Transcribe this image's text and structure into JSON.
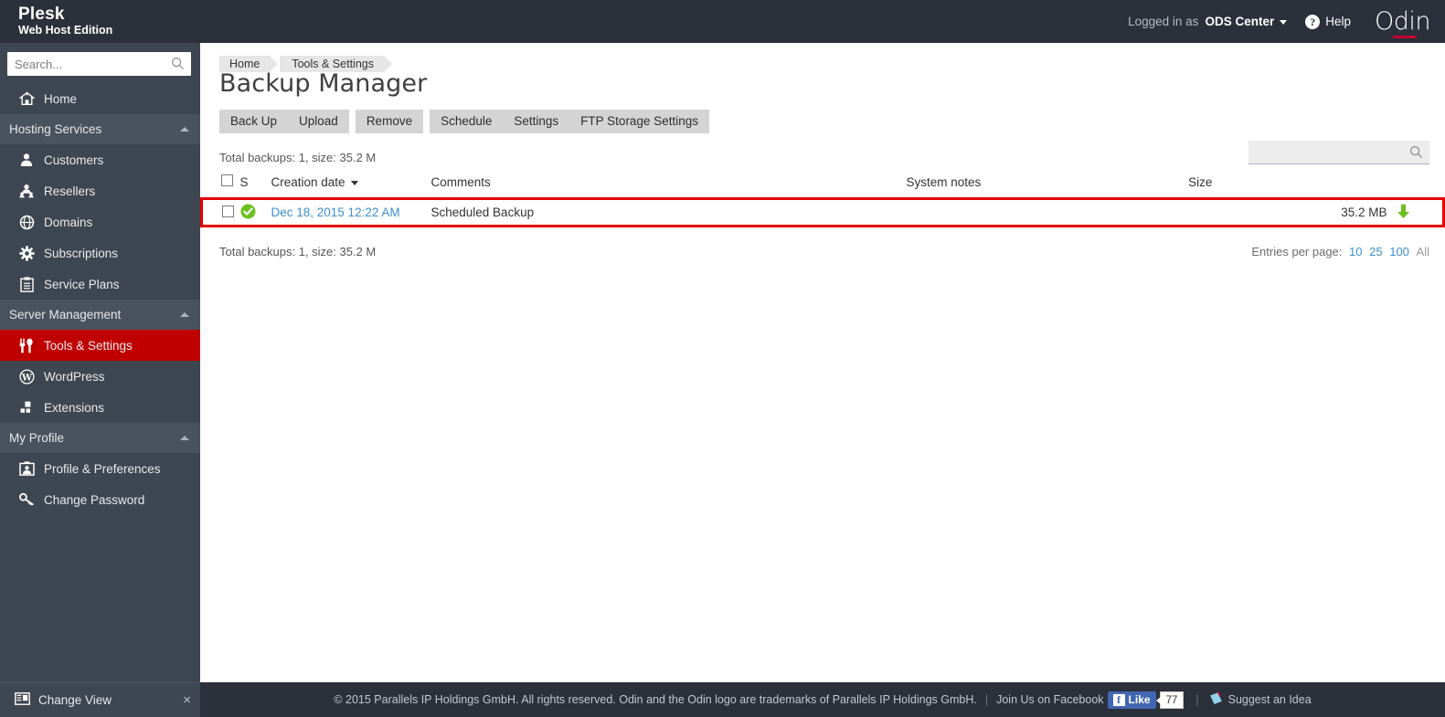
{
  "header": {
    "brand_name": "Plesk",
    "brand_edition": "Web Host Edition",
    "logged_in_label": "Logged in as",
    "user_name": "ODS Center",
    "help_label": "Help",
    "logo_text": "Odin",
    "icons": {
      "help": "help-circle-icon",
      "user_caret": "chevron-down-icon"
    },
    "colors": {
      "bar_bg": "#2b303b",
      "logo_underline": "#c3002f"
    }
  },
  "sidebar": {
    "search": {
      "placeholder": "Search...",
      "value": "",
      "icon": "search-icon"
    },
    "items": [
      {
        "label": "Home",
        "icon": "home-icon",
        "type": "item",
        "active": false
      },
      {
        "label": "Hosting Services",
        "icon": "chevron-up-icon",
        "type": "section"
      },
      {
        "label": "Customers",
        "icon": "user-icon",
        "type": "item",
        "active": false
      },
      {
        "label": "Resellers",
        "icon": "reseller-icon",
        "type": "item",
        "active": false
      },
      {
        "label": "Domains",
        "icon": "globe-icon",
        "type": "item",
        "active": false
      },
      {
        "label": "Subscriptions",
        "icon": "gear-icon",
        "type": "item",
        "active": false
      },
      {
        "label": "Service Plans",
        "icon": "clipboard-icon",
        "type": "item",
        "active": false
      },
      {
        "label": "Server Management",
        "icon": "chevron-up-icon",
        "type": "section"
      },
      {
        "label": "Tools & Settings",
        "icon": "tools-icon",
        "type": "item",
        "active": true
      },
      {
        "label": "WordPress",
        "icon": "wordpress-icon",
        "type": "item",
        "active": false
      },
      {
        "label": "Extensions",
        "icon": "extensions-icon",
        "type": "item",
        "active": false
      },
      {
        "label": "My Profile",
        "icon": "chevron-up-icon",
        "type": "section"
      },
      {
        "label": "Profile & Preferences",
        "icon": "profile-icon",
        "type": "item",
        "active": false
      },
      {
        "label": "Change Password",
        "icon": "key-icon",
        "type": "item",
        "active": false
      }
    ],
    "change_view": {
      "label": "Change View",
      "icon": "layout-icon",
      "close_icon": "close-icon",
      "close_glyph": "×"
    },
    "colors": {
      "bg": "#3e4651",
      "section_bg": "#4a525e",
      "active_bg": "#c00000"
    }
  },
  "breadcrumb": {
    "items": [
      "Home",
      "Tools & Settings"
    ]
  },
  "page": {
    "title": "Backup Manager"
  },
  "toolbar": {
    "buttons": [
      {
        "label": "Back Up"
      },
      {
        "label": "Upload"
      },
      {
        "label": "Remove"
      },
      {
        "label": "Schedule"
      },
      {
        "label": "Settings"
      },
      {
        "label": "FTP Storage Settings"
      }
    ]
  },
  "list_search": {
    "placeholder": "",
    "value": "",
    "icon": "search-icon"
  },
  "list": {
    "totals_text": "Total backups: 1, size: 35.2 M",
    "entries_label": "Entries per page:",
    "entries_options": [
      {
        "label": "10",
        "selected": false
      },
      {
        "label": "25",
        "selected": false
      },
      {
        "label": "100",
        "selected": false
      },
      {
        "label": "All",
        "selected": true
      }
    ],
    "columns": [
      {
        "key": "select",
        "label": ""
      },
      {
        "key": "status",
        "label": "S"
      },
      {
        "key": "creation_date",
        "label": "Creation date",
        "sorted": true,
        "sort_dir": "desc"
      },
      {
        "key": "comments",
        "label": "Comments"
      },
      {
        "key": "system_notes",
        "label": "System notes"
      },
      {
        "key": "size",
        "label": "Size"
      },
      {
        "key": "download",
        "label": ""
      }
    ],
    "rows": [
      {
        "selected": false,
        "status_icon": "check-circle-icon",
        "status_color": "#6cbf1f",
        "creation_date": "Dec 18, 2015 12:22 AM",
        "comments": "Scheduled Backup",
        "system_notes": "",
        "size": "35.2 MB",
        "download_icon": "download-arrow-icon",
        "download_color": "#6cbf1f",
        "highlighted": true,
        "highlight_color": "#e60000"
      }
    ]
  },
  "footer": {
    "copyright": "© 2015 Parallels IP Holdings GmbH. All rights reserved. Odin and the Odin logo are trademarks of Parallels IP Holdings GmbH.",
    "facebook_text": "Join Us on Facebook",
    "like_label": "Like",
    "like_count": "77",
    "facebook_glyph": "f",
    "suggest_text": "Suggest an Idea",
    "suggest_icon": "pencil-note-icon",
    "separator": "|"
  }
}
